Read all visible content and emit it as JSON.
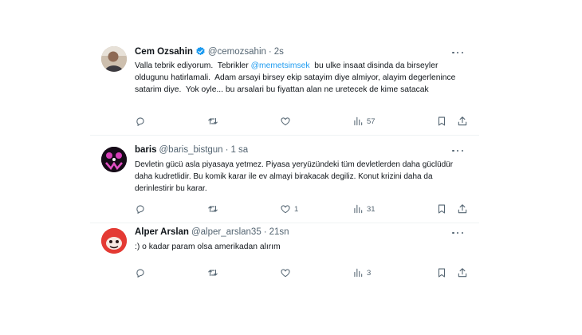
{
  "tweets": [
    {
      "name": "Cem Ozsahin",
      "handle": "@cemozsahin",
      "dot": "·",
      "time": "2s",
      "verified": true,
      "text_before": "Valla tebrik ediyorum.  Tebrikler ",
      "mention": "@memetsimsek",
      "text_after": "  bu ulke insaat disinda da birseyler oldugunu hatirlamali.  Adam arsayi birsey ekip satayim diye almiyor, alayim degerlenince satarim diye.  Yok oyle... bu arsalari bu fiyattan alan ne uretecek de kime satacak",
      "views": "57",
      "likes": "",
      "retweets": "",
      "replies": ""
    },
    {
      "name": "baris",
      "handle": "@baris_bistgun",
      "dot": "·",
      "time": "1 sa",
      "verified": false,
      "text": "Devletin gücü asla piyasaya yetmez. Piyasa yeryüzündeki tüm devletlerden daha güclüdür daha kudretlidir. Bu komik karar ile ev almayi birakacak degiliz. Konut krizini daha da derinlestirir bu karar.",
      "views": "31",
      "likes": "1",
      "retweets": "",
      "replies": ""
    },
    {
      "name": "Alper Arslan",
      "handle": "@alper_arslan35",
      "dot": "·",
      "time": "21sn",
      "verified": false,
      "text": ":) o kadar param olsa amerikadan alırım",
      "views": "3",
      "likes": "",
      "retweets": "",
      "replies": ""
    }
  ],
  "icons": {
    "reply": "reply-icon",
    "retweet": "retweet-icon",
    "like": "heart-icon",
    "views": "views-icon",
    "bookmark": "bookmark-icon",
    "share": "share-icon",
    "more": "more-icon",
    "verified": "verified-badge-icon"
  },
  "colors": {
    "accent": "#1d9bf0",
    "secondary_text": "#536471",
    "divider": "#eff3f4"
  }
}
